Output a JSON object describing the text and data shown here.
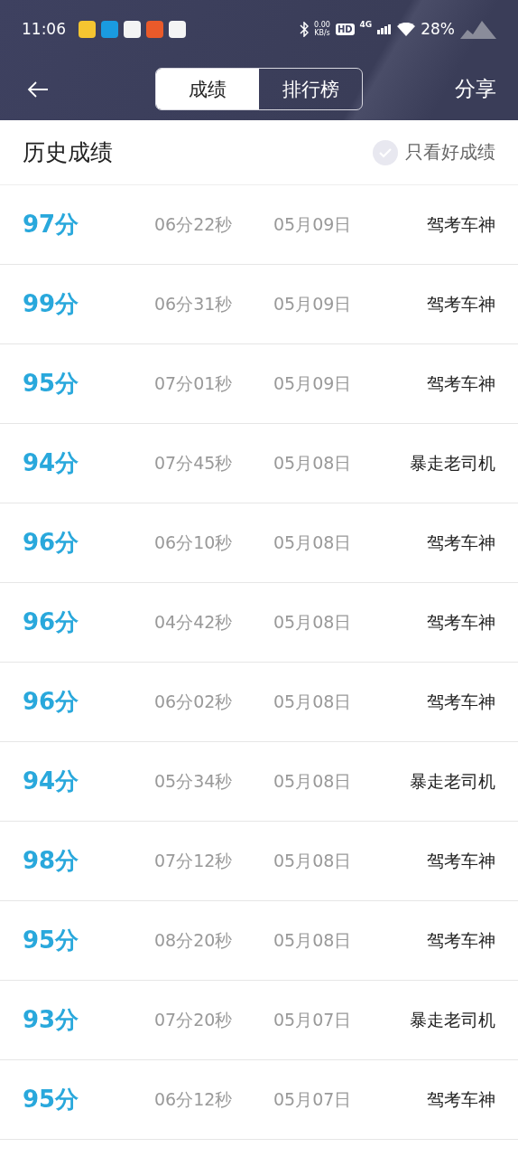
{
  "status_bar": {
    "time": "11:06",
    "net_speed": "0.00",
    "net_unit": "KB/s",
    "hd": "HD",
    "network": "4G",
    "battery": "28%"
  },
  "header": {
    "tabs": [
      {
        "label": "成绩",
        "selected": true
      },
      {
        "label": "排行榜",
        "selected": false
      }
    ],
    "share": "分享"
  },
  "history": {
    "title": "历史成绩",
    "filter": {
      "label": "只看好成绩",
      "checked": false
    }
  },
  "rows": [
    {
      "score": "97分",
      "duration": "06分22秒",
      "date": "05月09日",
      "title": "驾考车神"
    },
    {
      "score": "99分",
      "duration": "06分31秒",
      "date": "05月09日",
      "title": "驾考车神"
    },
    {
      "score": "95分",
      "duration": "07分01秒",
      "date": "05月09日",
      "title": "驾考车神"
    },
    {
      "score": "94分",
      "duration": "07分45秒",
      "date": "05月08日",
      "title": "暴走老司机"
    },
    {
      "score": "96分",
      "duration": "06分10秒",
      "date": "05月08日",
      "title": "驾考车神"
    },
    {
      "score": "96分",
      "duration": "04分42秒",
      "date": "05月08日",
      "title": "驾考车神"
    },
    {
      "score": "96分",
      "duration": "06分02秒",
      "date": "05月08日",
      "title": "驾考车神"
    },
    {
      "score": "94分",
      "duration": "05分34秒",
      "date": "05月08日",
      "title": "暴走老司机"
    },
    {
      "score": "98分",
      "duration": "07分12秒",
      "date": "05月08日",
      "title": "驾考车神"
    },
    {
      "score": "95分",
      "duration": "08分20秒",
      "date": "05月08日",
      "title": "驾考车神"
    },
    {
      "score": "93分",
      "duration": "07分20秒",
      "date": "05月07日",
      "title": "暴走老司机"
    },
    {
      "score": "95分",
      "duration": "06分12秒",
      "date": "05月07日",
      "title": "驾考车神"
    }
  ]
}
